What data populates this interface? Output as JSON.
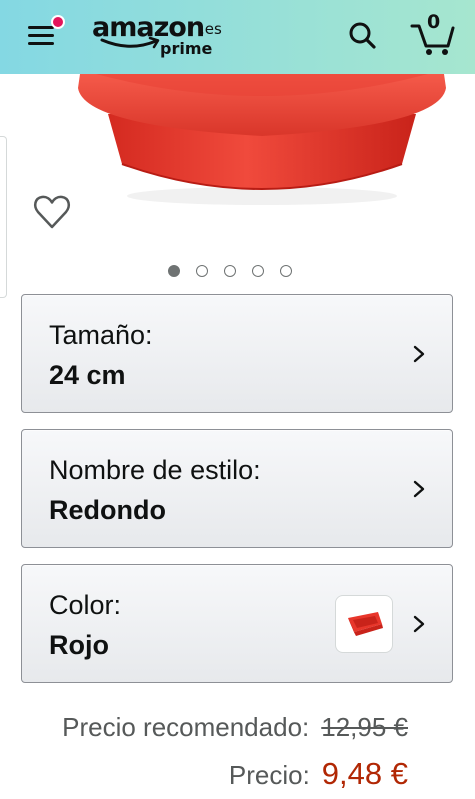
{
  "header": {
    "logo_word": "amazon",
    "logo_tld": ".es",
    "logo_sub": "prime",
    "cart_count": "0",
    "icons": {
      "menu": "hamburger-menu-icon",
      "search": "search-icon",
      "cart": "cart-icon",
      "notification": "notification-dot-icon"
    },
    "colors": {
      "gradient_start": "#84d8e3",
      "gradient_end": "#a6e6cf",
      "notification_dot": "#e3145a"
    }
  },
  "gallery": {
    "total_images": 5,
    "active_index": 0,
    "product_color": "#e8362b",
    "wishlist_icon": "heart-outline-icon"
  },
  "variants": [
    {
      "label": "Tamaño:",
      "value": "24 cm"
    },
    {
      "label": "Nombre de estilo:",
      "value": "Redondo"
    },
    {
      "label": "Color:",
      "value": "Rojo",
      "swatch_icon": "red-baking-mold-thumbnail"
    }
  ],
  "pricing": {
    "list_label": "Precio recomendado:",
    "list_price": "12,95 €",
    "price_label": "Precio:",
    "price": "9,48 €",
    "price_color": "#b12704"
  }
}
